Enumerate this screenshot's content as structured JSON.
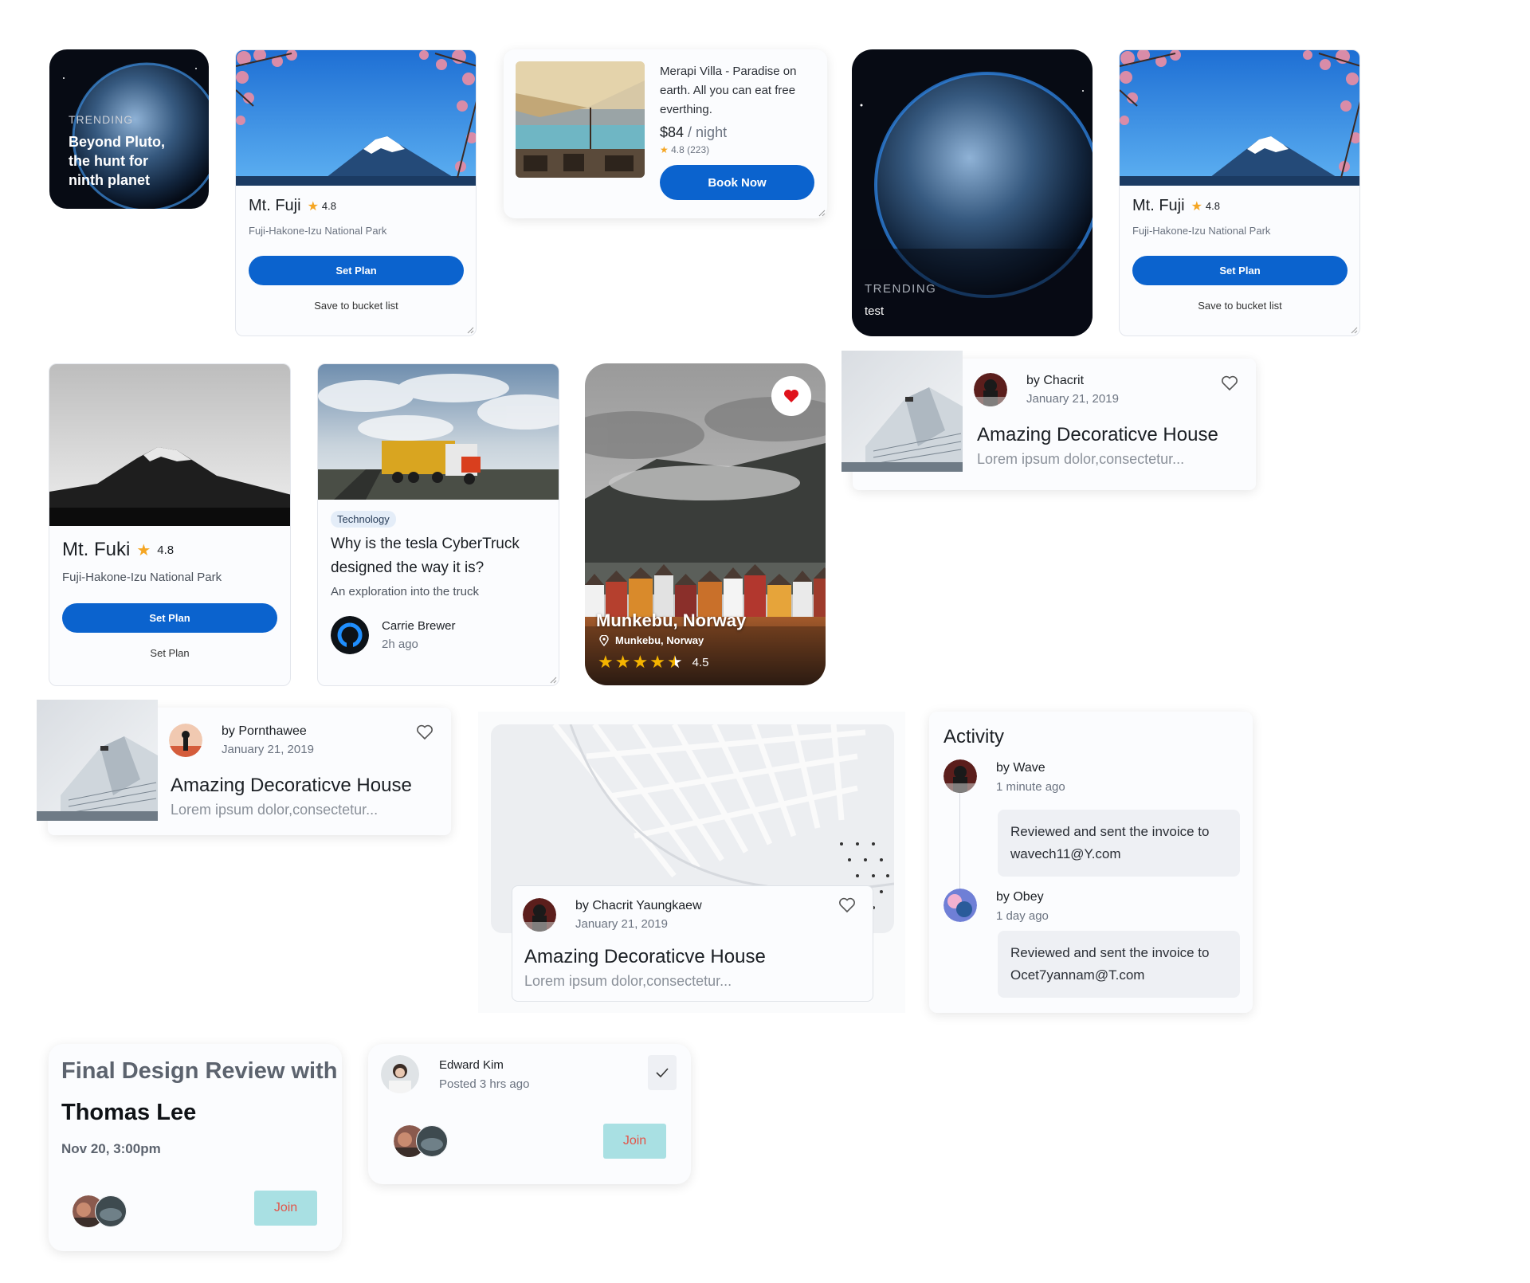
{
  "trending_small": {
    "label": "TRENDING",
    "title": "Beyond Pluto, the hunt for ninth planet"
  },
  "fuji_card_1": {
    "title": "Mt. Fuji",
    "rating": "4.8",
    "subtitle": "Fuji-Hakone-Izu National Park",
    "primary": "Set Plan",
    "secondary": "Save to bucket list"
  },
  "villa": {
    "title": "Merapi Villa - Paradise on earth. All you can eat free everthing.",
    "price": "$84",
    "per": " / night",
    "rating": "4.8 (223)",
    "button": "Book Now"
  },
  "trending_big": {
    "label": "TRENDING",
    "title": "test"
  },
  "fuji_card_2": {
    "title": "Mt. Fuji",
    "rating": "4.8",
    "subtitle": "Fuji-Hakone-Izu National Park",
    "primary": "Set Plan",
    "secondary": "Save to bucket list"
  },
  "fuki_card": {
    "title": "Mt. Fuki",
    "rating": "4.8",
    "subtitle": "Fuji-Hakone-Izu National Park",
    "primary": "Set Plan",
    "secondary": "Set Plan"
  },
  "truck_card": {
    "tag": "Technology",
    "title": "Why is the tesla CyberTruck designed the way it is?",
    "subtitle": "An exploration into the truck",
    "author": "Carrie Brewer",
    "time": "2h ago"
  },
  "norway_card": {
    "title": "Munkebu, Norway",
    "location": "Munkebu, Norway",
    "rating": "4.5",
    "stars": 4.5,
    "favorited": true
  },
  "house_card_1": {
    "by": "by",
    "author": "Chacrit",
    "date": "January 21, 2019",
    "title": "Amazing Decoraticve House",
    "excerpt": "Lorem ipsum dolor,consectetur..."
  },
  "house_card_2": {
    "by": "by",
    "author": "Pornthawee",
    "date": "January 21, 2019",
    "title": "Amazing Decoraticve House",
    "excerpt": "Lorem ipsum dolor,consectetur..."
  },
  "house_card_3": {
    "by": "by",
    "author": "Chacrit Yaungkaew",
    "date": "January 21, 2019",
    "title": "Amazing Decoraticve House",
    "excerpt": "Lorem ipsum dolor,consectetur..."
  },
  "activity": {
    "title": "Activity",
    "items": [
      {
        "by": "by",
        "name": "Wave",
        "time": "1 minute ago",
        "message": "Reviewed and sent the invoice to wavech11@Y.com"
      },
      {
        "by": "by",
        "name": "Obey",
        "time": "1 day ago",
        "message": "Reviewed and sent the invoice to Ocet7yannam@T.com"
      }
    ]
  },
  "design_review": {
    "title_line1": "Final Design Review with",
    "title_line2": "Thomas Lee",
    "date": "Nov 20, 3:00pm",
    "join": "Join"
  },
  "post_card": {
    "name": "Edward Kim",
    "time": "Posted 3 hrs ago",
    "join": "Join"
  },
  "colors": {
    "primary": "#0b63ce",
    "star": "#f5a623",
    "join_bg": "#a9e0e3",
    "join_text": "#e2554a",
    "heart": "#e0121b"
  }
}
